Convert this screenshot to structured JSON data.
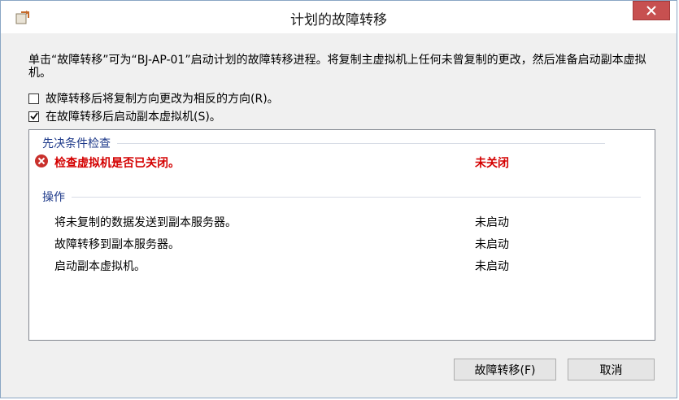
{
  "window": {
    "title": "计划的故障转移"
  },
  "description": "单击“故障转移”可为“BJ-AP-01”启动计划的故障转移进程。将复制主虚拟机上任何未曾复制的更改，然后准备启动副本虚拟机。",
  "options": [
    {
      "label": "故障转移后将复制方向更改为相反的方向(R)。",
      "checked": false
    },
    {
      "label": "在故障转移后启动副本虚拟机(S)。",
      "checked": true
    }
  ],
  "prereq": {
    "header": "先决条件检查",
    "items": [
      {
        "label": "检查虚拟机是否已关闭。",
        "status": "未关闭",
        "state": "error"
      }
    ]
  },
  "actions": {
    "header": "操作",
    "items": [
      {
        "label": "将未复制的数据发送到副本服务器。",
        "status": "未启动"
      },
      {
        "label": "故障转移到副本服务器。",
        "status": "未启动"
      },
      {
        "label": "启动副本虚拟机。",
        "status": "未启动"
      }
    ]
  },
  "buttons": {
    "failover": "故障转移(F)",
    "cancel": "取消"
  },
  "colors": {
    "error": "#d40000",
    "section_header": "#1e3a8a",
    "close_button": "#c75050"
  },
  "icons": {
    "app": "replication-icon",
    "close": "close-icon",
    "error": "error-icon",
    "check": "checkmark-icon"
  }
}
